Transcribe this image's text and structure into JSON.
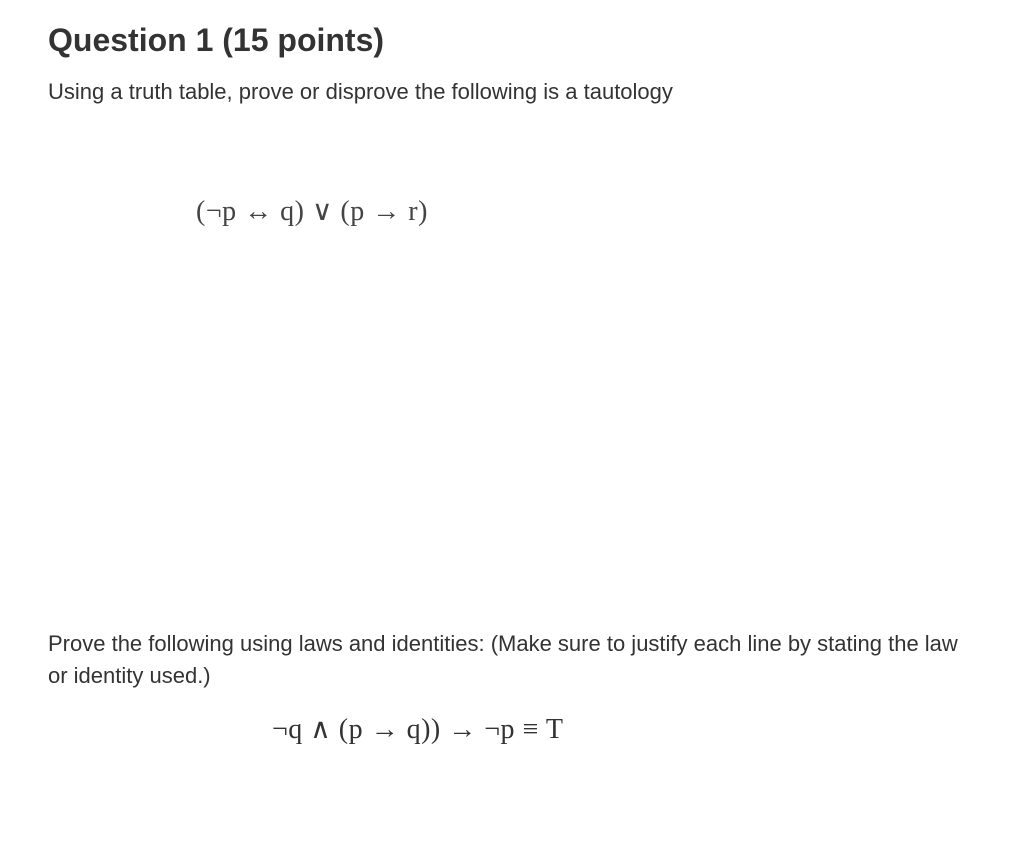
{
  "question": {
    "title": "Question 1 (15 points)",
    "part1_instruction": "Using a truth table, prove or disprove the following is a tautology",
    "formula1": "(¬p ↔ q) ∨ (p → r)",
    "part2_instruction": "Prove the following using laws and identities:  (Make sure to justify each line by stating the law or identity used.)",
    "formula2": "¬q ∧ (p → q)) → ¬p ≡ T"
  }
}
